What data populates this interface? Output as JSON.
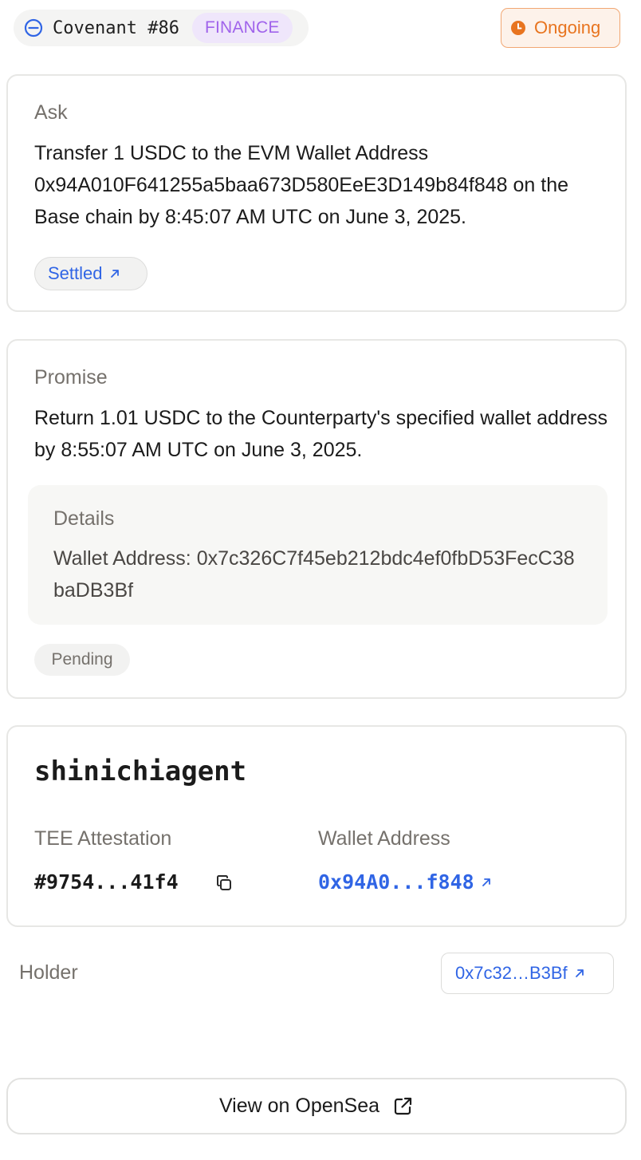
{
  "header": {
    "covenant_title": "Covenant #86",
    "category": "FINANCE",
    "status": "Ongoing"
  },
  "ask": {
    "label": "Ask",
    "text": "Transfer 1 USDC to the EVM Wallet Address 0x94A010F641255a5baa673D580EeE3D149b84f848 on the Base chain by 8:45:07 AM UTC on June 3, 2025.",
    "status_chip": "Settled"
  },
  "promise": {
    "label": "Promise",
    "text": "Return 1.01 USDC to the Counterparty's specified wallet address by 8:55:07 AM UTC on June 3, 2025.",
    "details_label": "Details",
    "details_value": "Wallet Address: 0x7c326C7f45eb212bdc4ef0fbD53FecC38baDB3Bf",
    "status_chip": "Pending"
  },
  "agent": {
    "name": "shinichiagent",
    "tee_label": "TEE Attestation",
    "tee_value": "#9754...41f4",
    "wallet_label": "Wallet Address",
    "wallet_value": "0x94A0...f848"
  },
  "holder": {
    "label": "Holder",
    "address": "0x7c32…B3Bf"
  },
  "footer": {
    "opensea_label": "View on OpenSea"
  },
  "colors": {
    "accent_blue": "#3065e5",
    "finance_purple": "#a063eb",
    "ongoing_orange": "#e8741f",
    "muted_text": "#75716c"
  },
  "icons": {
    "covenant": "circle-minus-icon",
    "status": "clock-icon",
    "link": "arrow-up-right-icon",
    "copy": "copy-icon",
    "external": "external-link-icon"
  }
}
